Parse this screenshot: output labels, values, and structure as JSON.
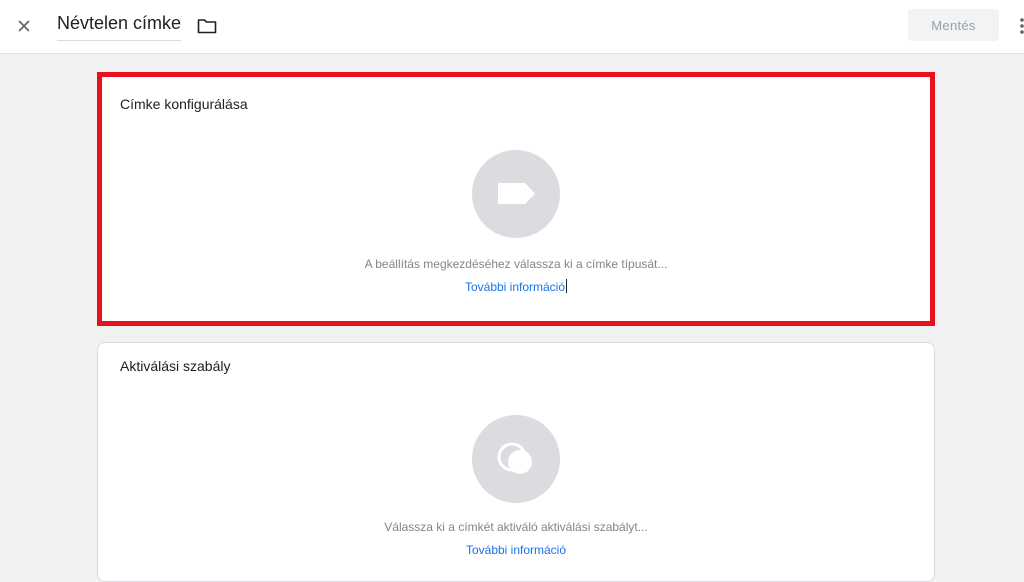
{
  "header": {
    "title": "Névtelen címke",
    "save_label": "Mentés",
    "icons": [
      "close-icon",
      "folder-icon",
      "more-vert-icon"
    ]
  },
  "tag_config": {
    "title": "Címke konfigurálása",
    "icon": "tag-icon",
    "hint": "A beállítás megkezdéséhez válassza ki a címke típusát...",
    "link": "További információ"
  },
  "trigger": {
    "title": "Aktiválási szabály",
    "icon": "trigger-icon",
    "hint": "Válassza ki a címkét aktiváló aktiválási szabályt...",
    "link": "További információ"
  },
  "colors": {
    "highlight_border": "#e8111e",
    "link": "#1a73e8",
    "icon_circle": "#dadce0"
  }
}
